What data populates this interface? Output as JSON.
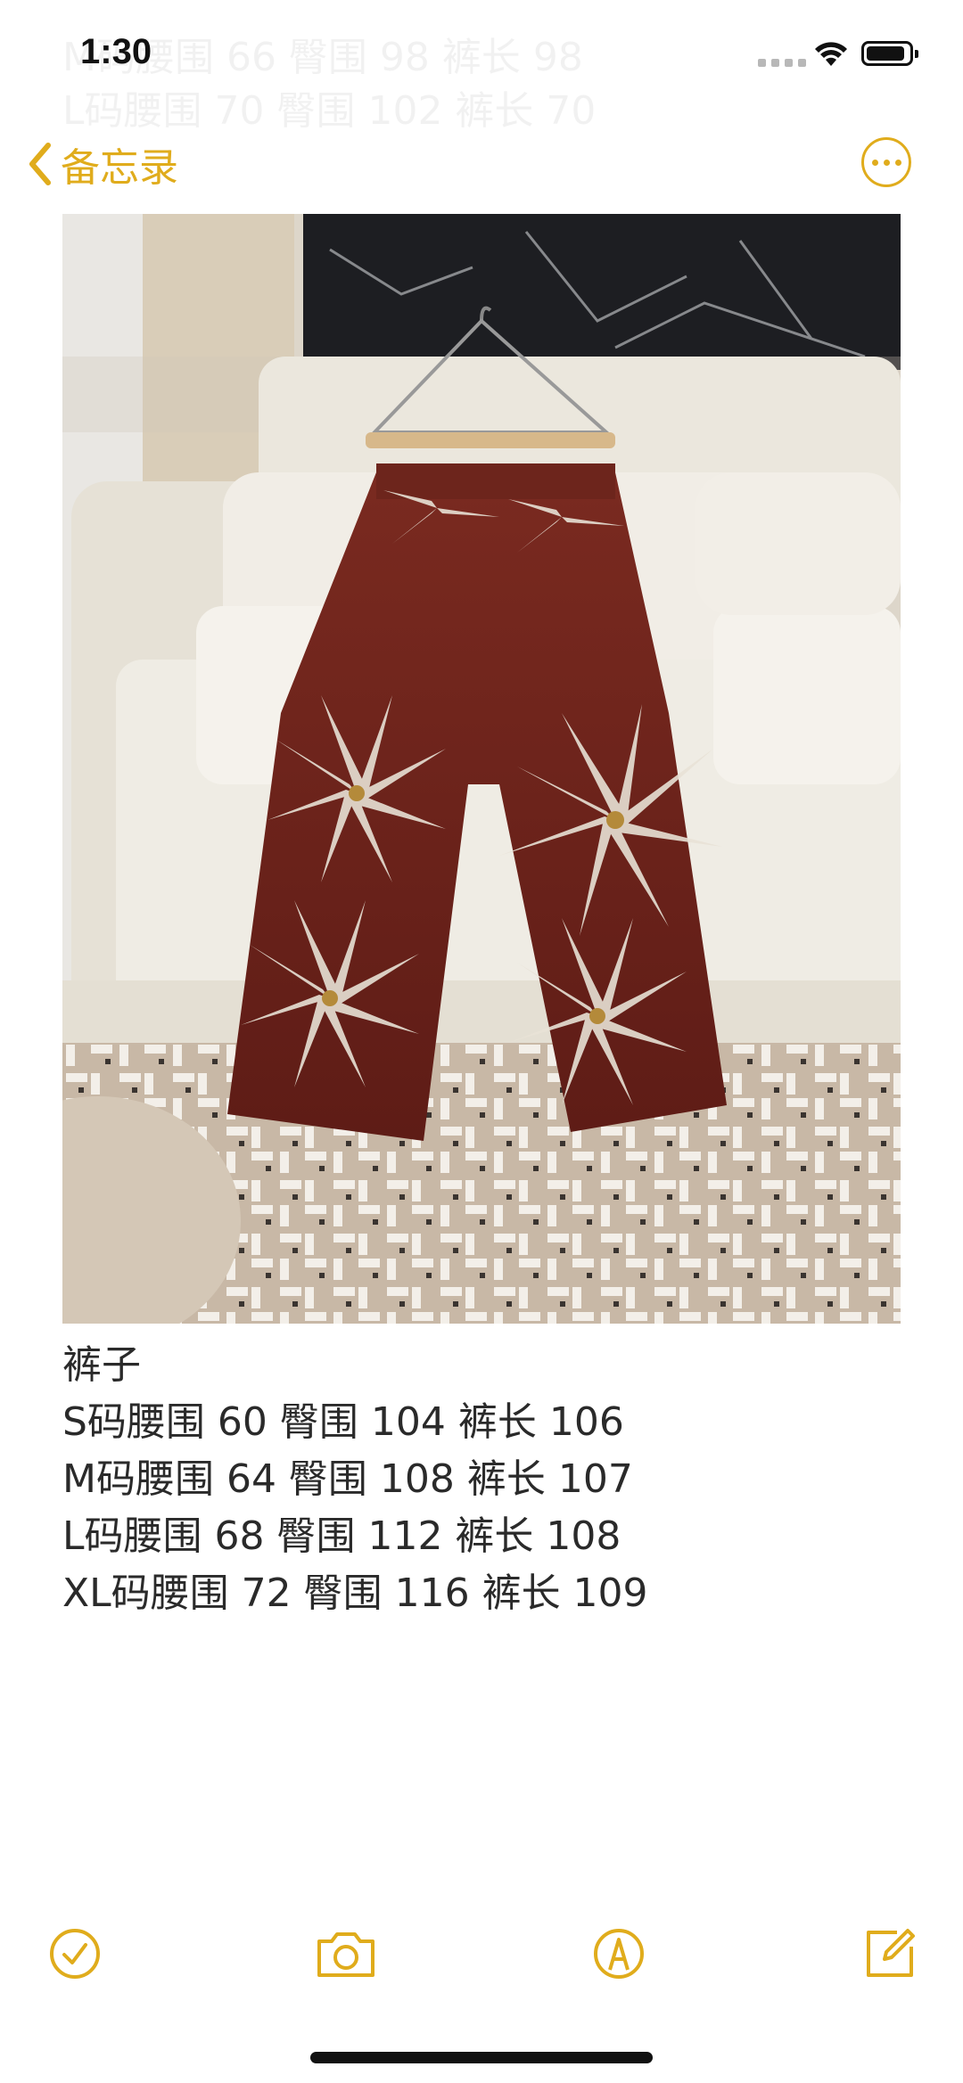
{
  "status_bar": {
    "time": "1:30"
  },
  "nav": {
    "back_label": "备忘录"
  },
  "ghost_lines": [
    "M码腰围 66 臀围 98 裤长 98",
    "L码腰围 70 臀围 102 裤长 70"
  ],
  "photo": {
    "description_icon": "photo-attachment"
  },
  "note": {
    "lines": [
      "裤子",
      "S码腰围 60 臀围 104 裤长 106",
      "M码腰围 64 臀围 108 裤长 107",
      "L码腰围 68 臀围 112 裤长 108",
      "XL码腰围 72 臀围 116 裤长 109"
    ]
  },
  "toolbar": {
    "icons": [
      "checklist-icon",
      "camera-icon",
      "markup-icon",
      "compose-icon"
    ]
  },
  "colors": {
    "accent": "#e0ac1c",
    "text": "#2a2a2a",
    "background": "#ffffff"
  }
}
